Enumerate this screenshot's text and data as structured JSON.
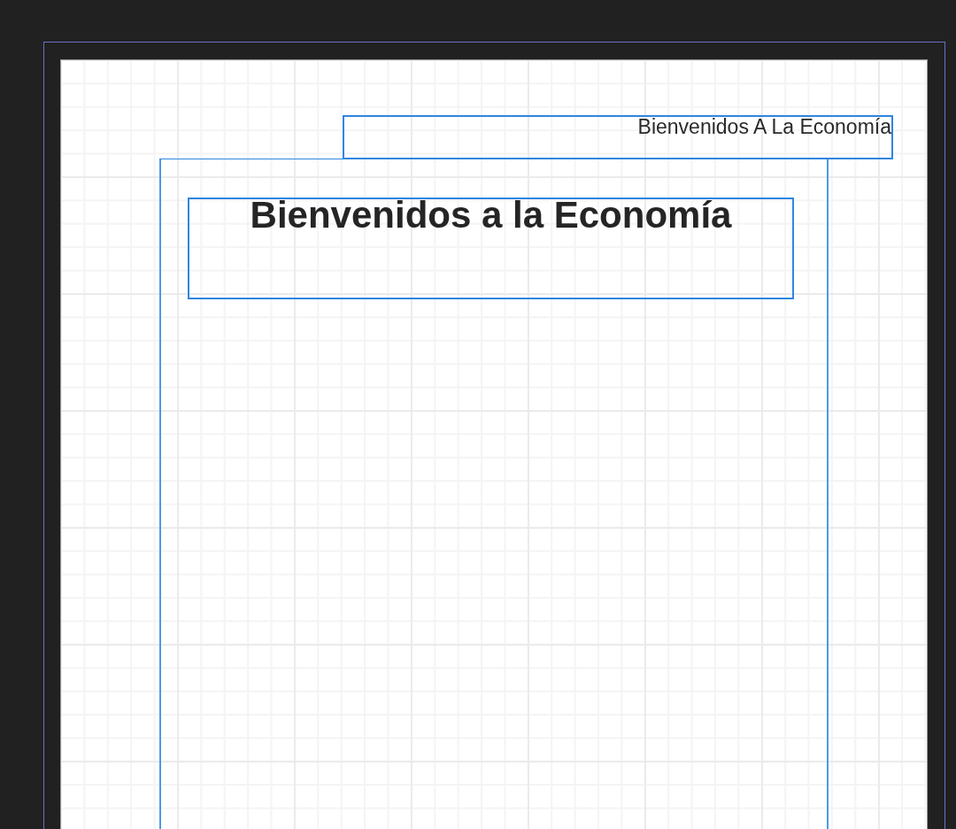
{
  "header": {
    "text": "Bienvenidos A La Economía"
  },
  "title": {
    "text": "Bienvenidos a la Economía"
  }
}
